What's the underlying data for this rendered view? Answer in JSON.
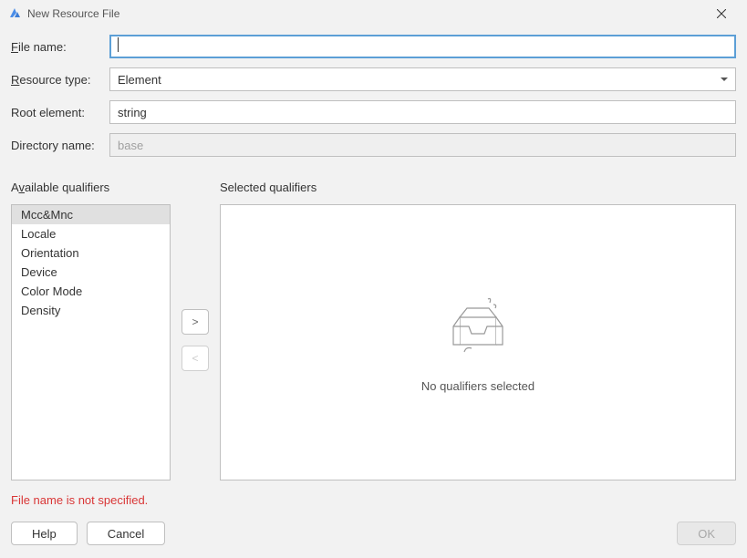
{
  "titlebar": {
    "title": "New Resource File"
  },
  "form": {
    "file_name_label": "File name:",
    "file_name_value": "",
    "resource_type_label": "Resource type:",
    "resource_type_value": "Element",
    "root_element_label": "Root element:",
    "root_element_value": "string",
    "directory_name_label": "Directory name:",
    "directory_name_value": "base"
  },
  "qualifiers": {
    "available_label": "Available qualifiers",
    "selected_label": "Selected qualifiers",
    "items": [
      "Mcc&Mnc",
      "Locale",
      "Orientation",
      "Device",
      "Color Mode",
      "Density"
    ],
    "move_right": ">",
    "move_left": "<",
    "empty_message": "No qualifiers selected"
  },
  "error": "File name is not specified.",
  "buttons": {
    "help": "Help",
    "cancel": "Cancel",
    "ok": "OK"
  }
}
